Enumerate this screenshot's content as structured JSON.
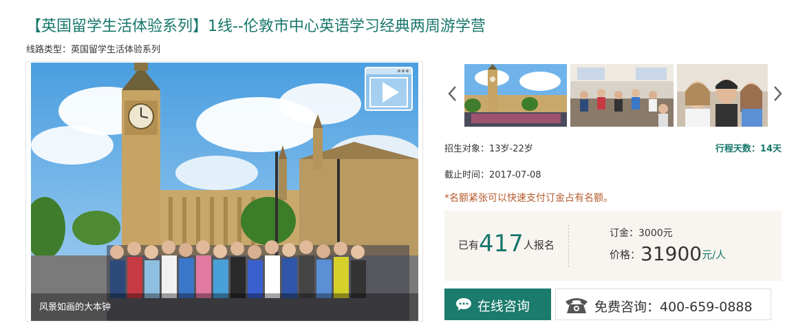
{
  "title": "【英国留学生活体验系列】1线--伦敦市中心英语学习经典两周游学营",
  "route_type": "线路类型：英国留学生活体验系列",
  "main_photo": {
    "caption": "风景如画的大本钟",
    "icon": "play-video-icon"
  },
  "gallery": {
    "prev_icon": "chevron-left-icon",
    "next_icon": "chevron-right-icon",
    "thumbnails": [
      "big-ben-group-photo",
      "classroom-photo",
      "students-selfie-photo"
    ]
  },
  "info": {
    "enroll_target": "招生对象：13岁-22岁",
    "duration": "行程天数：14天",
    "deadline": "截止时间：2017-07-08",
    "notice": "*名额紧张可以快速支付订金占有名额。"
  },
  "price_box": {
    "signup_prefix": "已有",
    "signup_count": "417",
    "signup_suffix": "人报名",
    "deposit": "订金：3000元",
    "price_label": "价格：",
    "price_value": "31900",
    "price_unit": "元/人"
  },
  "actions": {
    "online_consult": "在线咨询",
    "phone_consult": "免费咨询：400-659-0888"
  },
  "colors": {
    "accent": "#17766b",
    "button": "#1b7b6c",
    "notice": "#b45a2b",
    "price_bg": "#f8f5f0"
  }
}
